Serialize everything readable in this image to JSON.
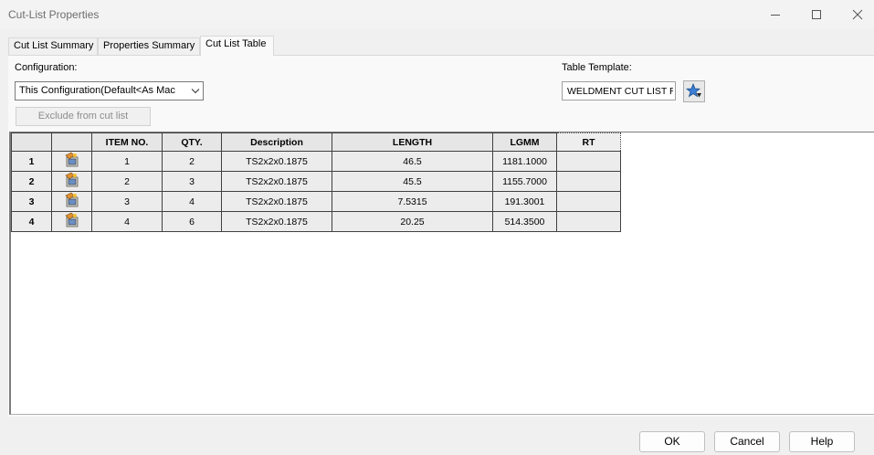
{
  "window": {
    "title": "Cut-List Properties"
  },
  "tabs": [
    {
      "label": "Cut List Summary",
      "active": false
    },
    {
      "label": "Properties Summary",
      "active": false
    },
    {
      "label": "Cut List Table",
      "active": true
    }
  ],
  "configuration": {
    "label": "Configuration:",
    "value": "This Configuration(Default<As Mac"
  },
  "exclude_button": {
    "label": "Exclude from cut list"
  },
  "table_template": {
    "label": "Table Template:",
    "value": "WELDMENT CUT LIST RI",
    "button_icon": "star-download-icon"
  },
  "grid": {
    "columns": [
      "",
      "",
      "ITEM NO.",
      "QTY.",
      "Description",
      "LENGTH",
      "LGMM",
      "RT"
    ],
    "rows": [
      {
        "row": "1",
        "icon": "weldment-part-icon",
        "item": "1",
        "qty": "2",
        "description": "TS2x2x0.1875",
        "length": "46.5",
        "lgmm": "1181.1000",
        "rt": ""
      },
      {
        "row": "2",
        "icon": "weldment-part-icon",
        "item": "2",
        "qty": "3",
        "description": "TS2x2x0.1875",
        "length": "45.5",
        "lgmm": "1155.7000",
        "rt": ""
      },
      {
        "row": "3",
        "icon": "weldment-part-icon",
        "item": "3",
        "qty": "4",
        "description": "TS2x2x0.1875",
        "length": "7.5315",
        "lgmm": "191.3001",
        "rt": ""
      },
      {
        "row": "4",
        "icon": "weldment-part-icon",
        "item": "4",
        "qty": "6",
        "description": "TS2x2x0.1875",
        "length": "20.25",
        "lgmm": "514.3500",
        "rt": ""
      }
    ]
  },
  "buttons": {
    "ok": "OK",
    "cancel": "Cancel",
    "help": "Help"
  }
}
